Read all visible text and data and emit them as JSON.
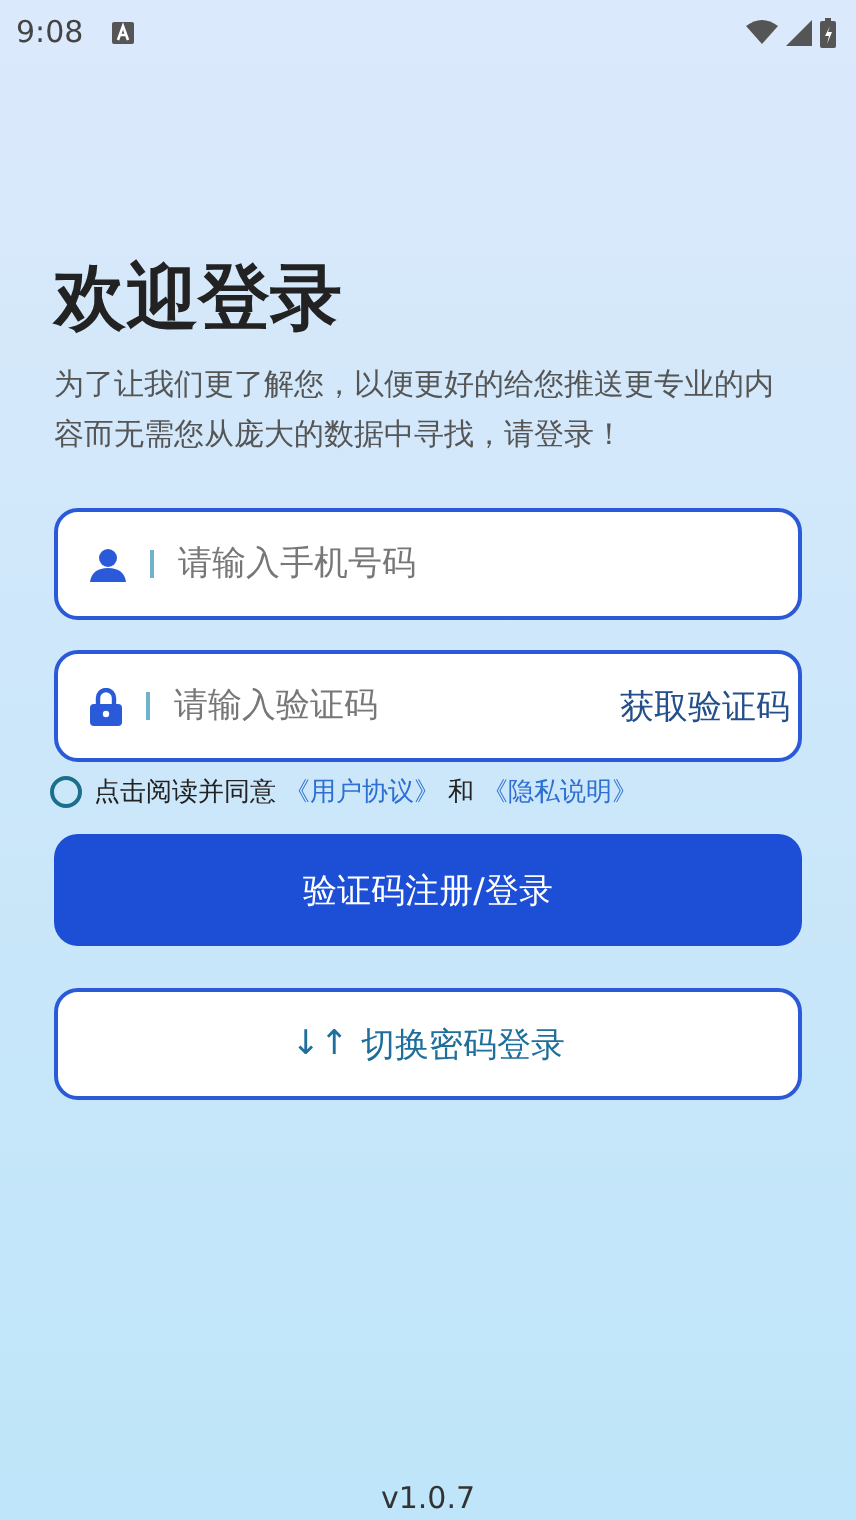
{
  "status_bar": {
    "time": "9:08"
  },
  "title": "欢迎登录",
  "subtitle": "为了让我们更了解您，以便更好的给您推送更专业的内容而无需您从庞大的数据中寻找，请登录！",
  "phone_field": {
    "placeholder": "请输入手机号码"
  },
  "code_field": {
    "placeholder": "请输入验证码",
    "action": "获取验证码"
  },
  "agreement": {
    "checked": false,
    "text": "点击阅读并同意",
    "link1": "《用户协议》",
    "and": "和",
    "link2": "《隐私说明》"
  },
  "login_button": "验证码注册/登录",
  "switch_button": {
    "icon": "↓↑",
    "label": "切换密码登录"
  },
  "version": "v1.0.7"
}
